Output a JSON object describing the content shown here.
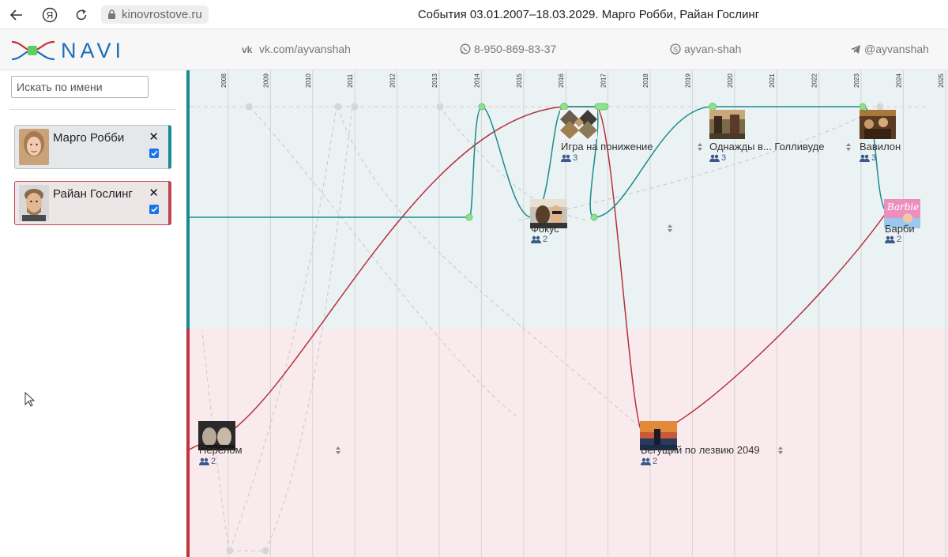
{
  "browser": {
    "url": "kinovrostove.ru",
    "title": "События 03.01.2007–18.03.2029. Марго Робби, Райан Гослинг"
  },
  "header": {
    "logo_text": "NAVI",
    "contacts": {
      "vk": "vk.com/ayvanshah",
      "whatsapp": "8-950-869-83-37",
      "skype": "ayvan-shah",
      "telegram": "@ayvanshah"
    }
  },
  "sidebar": {
    "search_placeholder": "Искать по имени",
    "people": [
      {
        "name": "Марго Робби",
        "checked": true,
        "color": "#1a8a94"
      },
      {
        "name": "Райан Гослинг",
        "checked": true,
        "color": "#c0444e"
      }
    ]
  },
  "timeline": {
    "years": [
      "2008",
      "2009",
      "2010",
      "2011",
      "2012",
      "2013",
      "2014",
      "2015",
      "2016",
      "2017",
      "2018",
      "2019",
      "2020",
      "2021",
      "2022",
      "2023",
      "2024",
      "2025"
    ],
    "films": [
      {
        "title": "Игра на понижение",
        "count": "3"
      },
      {
        "title": "Однажды в... Голливуде",
        "count": "3"
      },
      {
        "title": "Вавилон",
        "count": "3"
      },
      {
        "title": "Фокус",
        "count": "2"
      },
      {
        "title": "Барби",
        "count": "2"
      },
      {
        "title": "Перелом",
        "count": "2"
      },
      {
        "title": "Бегущий по лезвию 2049",
        "count": "2"
      }
    ],
    "colors": {
      "robbie": "#1a8a94",
      "gosling": "#b5303a",
      "node": "#8de08d"
    }
  }
}
